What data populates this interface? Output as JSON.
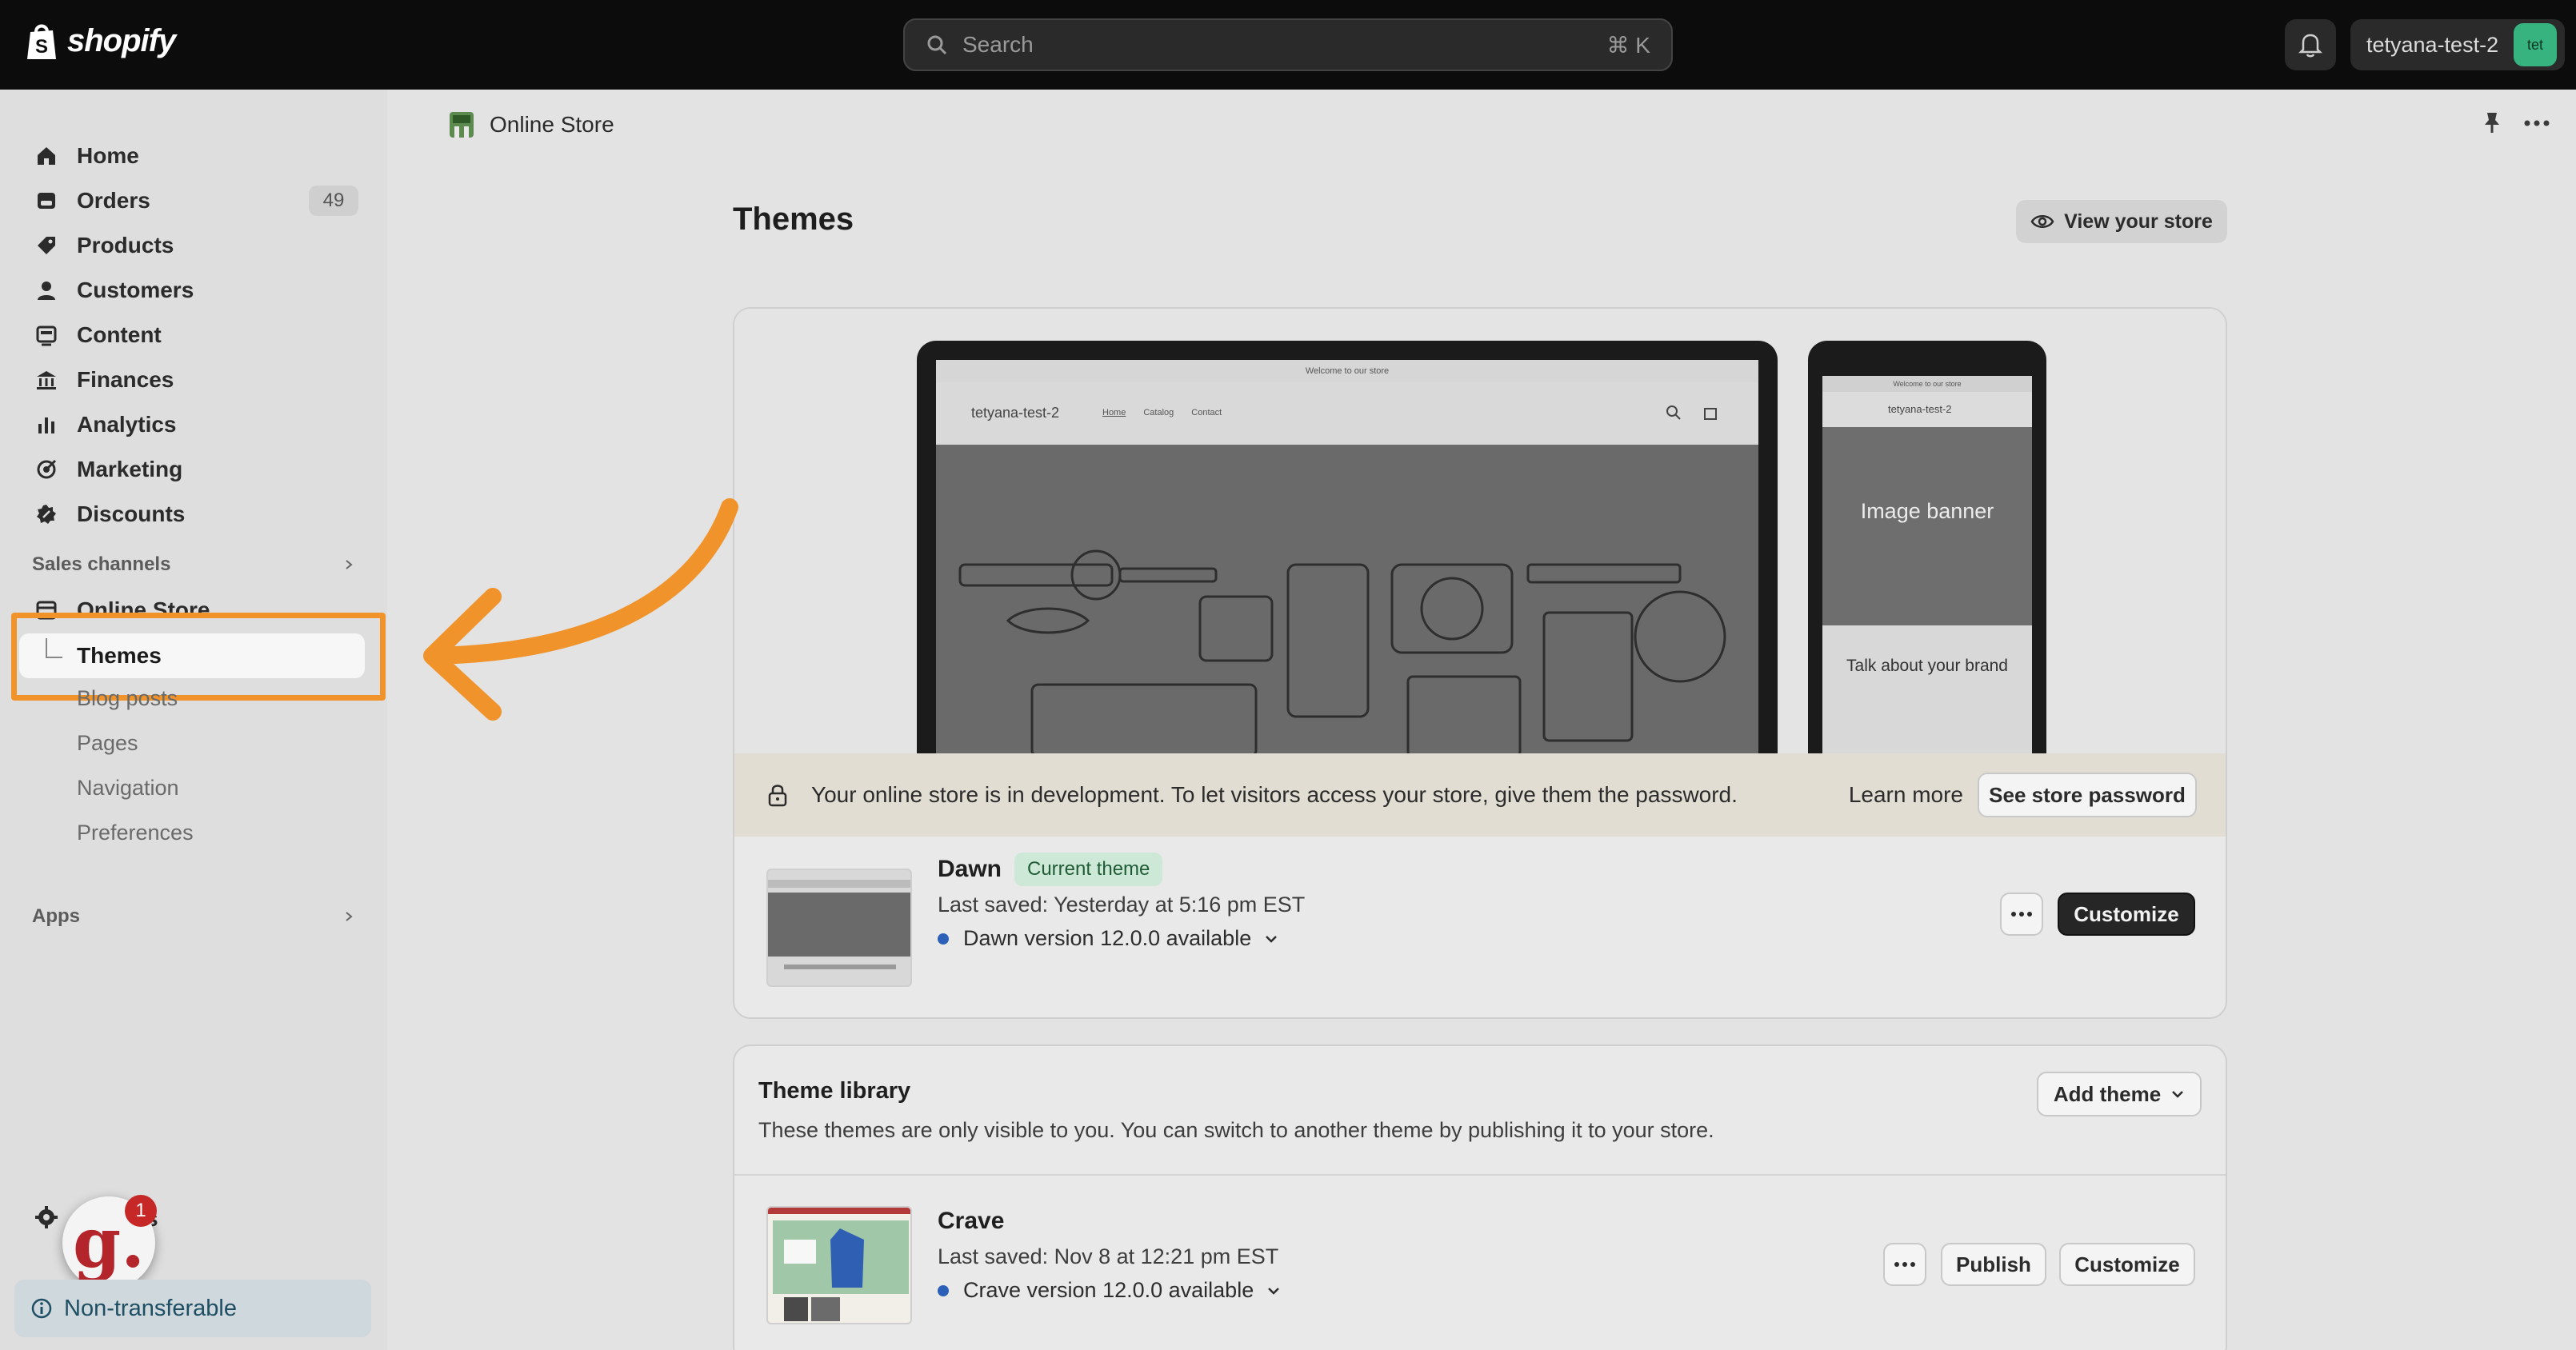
{
  "topbar": {
    "logo_text": "shopify",
    "search_placeholder": "Search",
    "search_shortcut": "⌘ K",
    "account_name": "tetyana-test-2",
    "avatar_initials": "tet"
  },
  "sidebar": {
    "items": [
      {
        "label": "Home",
        "icon": "home-icon"
      },
      {
        "label": "Orders",
        "icon": "orders-icon",
        "count": "49"
      },
      {
        "label": "Products",
        "icon": "tag-icon"
      },
      {
        "label": "Customers",
        "icon": "person-icon"
      },
      {
        "label": "Content",
        "icon": "content-icon"
      },
      {
        "label": "Finances",
        "icon": "bank-icon"
      },
      {
        "label": "Analytics",
        "icon": "bar-chart-icon"
      },
      {
        "label": "Marketing",
        "icon": "target-icon"
      },
      {
        "label": "Discounts",
        "icon": "discount-icon"
      }
    ],
    "sales_channels_label": "Sales channels",
    "online_store_label": "Online Store",
    "sub_items": [
      "Themes",
      "Blog posts",
      "Pages",
      "Navigation",
      "Preferences"
    ],
    "apps_label": "Apps",
    "settings_fragment": "s",
    "non_transferable": "Non-transferable",
    "guide_badge": "1",
    "guide_letter": "g."
  },
  "header": {
    "breadcrumb": "Online Store"
  },
  "main": {
    "title": "Themes",
    "view_store_label": "View your store",
    "preview": {
      "announcement": "Welcome to our store",
      "store_name": "tetyana-test-2",
      "nav_links": [
        "Home",
        "Catalog",
        "Contact"
      ],
      "mobile_banner": "Image banner",
      "mobile_talk": "Talk about your brand"
    },
    "notice": {
      "message": "Your online store is in development. To let visitors access your store, give them the password.",
      "learn_more": "Learn more",
      "button": "See store password"
    },
    "current_theme": {
      "name": "Dawn",
      "badge": "Current theme",
      "saved": "Last saved: Yesterday at 5:16 pm EST",
      "version": "Dawn version 12.0.0 available",
      "customize": "Customize"
    },
    "library": {
      "title": "Theme library",
      "description": "These themes are only visible to you. You can switch to another theme by publishing it to your store.",
      "add_theme": "Add theme",
      "themes": [
        {
          "name": "Crave",
          "saved": "Last saved: Nov 8 at 12:21 pm EST",
          "version": "Crave version 12.0.0 available",
          "publish": "Publish",
          "customize": "Customize"
        }
      ]
    }
  },
  "colors": {
    "accent_arrow": "#f0932b",
    "topbar": "#0c0c0c",
    "status_dot": "#2c5fb8",
    "current_badge_bg": "#cde8d6"
  }
}
